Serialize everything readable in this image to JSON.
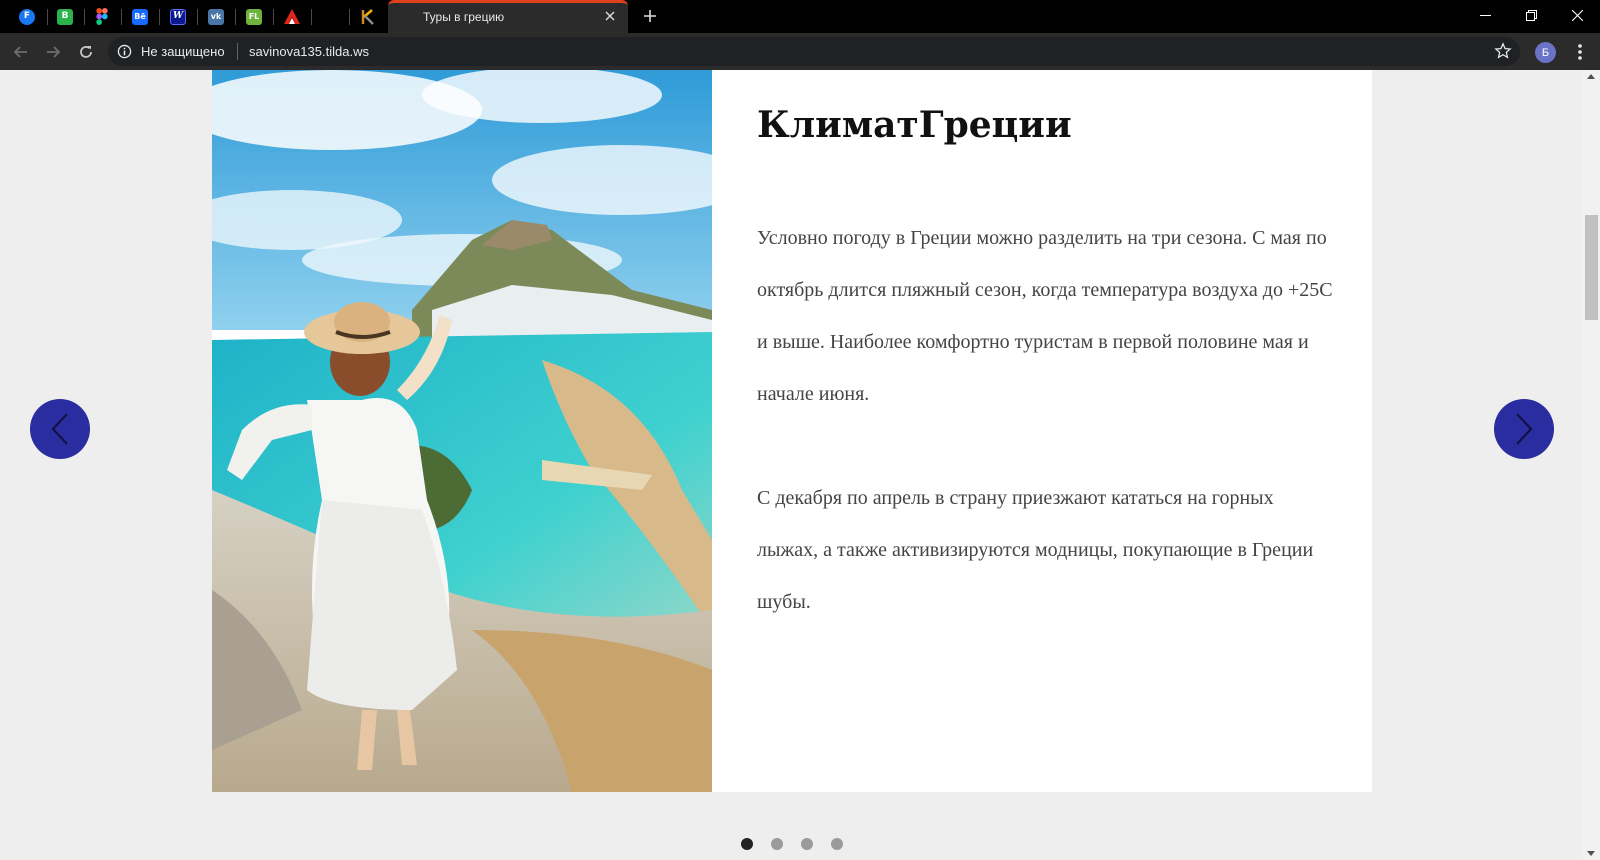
{
  "browser": {
    "pinned_tabs": [
      {
        "icon": "fb-icon",
        "glyph": "F",
        "color": "#1877f2"
      },
      {
        "icon": "green-b-icon",
        "glyph": "B",
        "color": "#2bb24c"
      },
      {
        "icon": "figma-icon",
        "glyph": "",
        "color": "#f24e1e"
      },
      {
        "icon": "behance-icon",
        "glyph": "Bē",
        "color": "#1769ff"
      },
      {
        "icon": "word-w-icon",
        "glyph": "W",
        "color": "#2b3fd1"
      },
      {
        "icon": "vk-icon",
        "glyph": "vk",
        "color": "#4a76a8"
      },
      {
        "icon": "fl-icon",
        "glyph": "FL",
        "color": "#6fb33f"
      },
      {
        "icon": "adobe-icon",
        "glyph": "A",
        "color": "#e1251b"
      },
      {
        "icon": "blank-icon",
        "glyph": "",
        "color": "#000000"
      },
      {
        "icon": "k-logo-icon",
        "glyph": "K",
        "color": "#000000"
      }
    ],
    "active_tab_title": "Туры в грецию",
    "security_label": "Не защищено",
    "url": "savinova135.tilda.ws",
    "profile_initial": "Б",
    "accent_color": "#e0401c"
  },
  "slide": {
    "title": "КлиматГреции",
    "paragraphs": [
      "Условно погоду в Греции можно разделить на три сезона. С мая по октябрь длится пляжный сезон, когда температура воздуха до +25С и выше. Наиболее комфортно туристам в первой половине мая и начале июня.",
      "С декабря по апрель в страну приезжают кататься на горных лыжах, а также активизируются модницы, покупающие в Греции шубы."
    ],
    "image": "woman-on-cliff-over-bay-photo",
    "arrow_color": "#2a2da0"
  },
  "pagination": {
    "count": 4,
    "active_index": 0
  }
}
